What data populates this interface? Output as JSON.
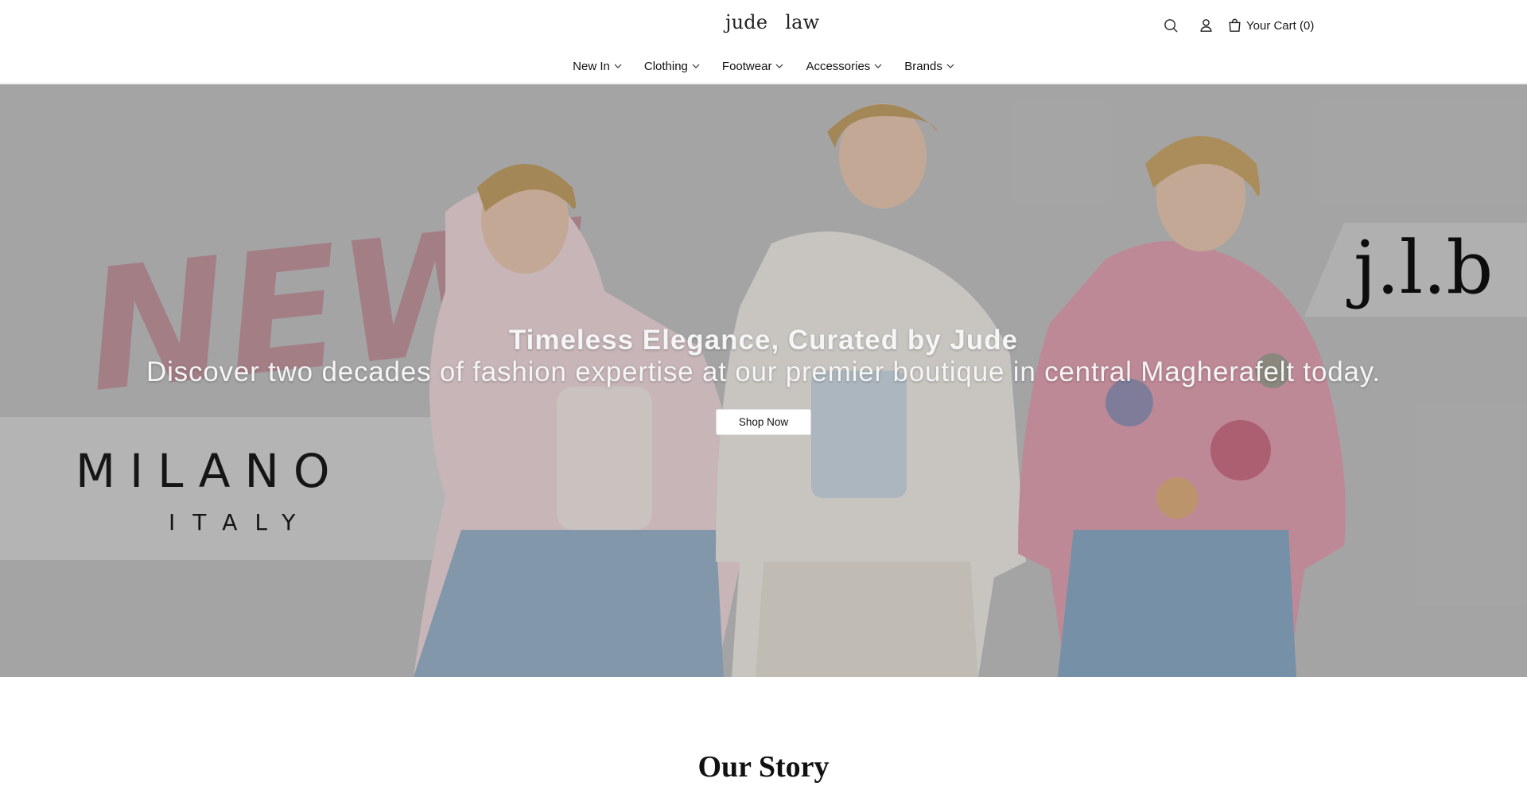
{
  "header": {
    "logo_left": "jude",
    "logo_right": "law",
    "cart_label": "Your Cart (0)"
  },
  "nav": {
    "items": [
      {
        "label": "New In"
      },
      {
        "label": "Clothing"
      },
      {
        "label": "Footwear"
      },
      {
        "label": "Accessories"
      },
      {
        "label": "Brands"
      }
    ]
  },
  "hero": {
    "title": "Timeless Elegance, Curated by Jude",
    "subtitle": "Discover two decades of fashion expertise at our premier boutique in central Magherafelt today.",
    "cta_label": "Shop Now",
    "banner_new": "NEW!",
    "banner_brand_left": "MILANO",
    "banner_brand_left_sub": "ITALY",
    "banner_brand_right": "j.l.b"
  },
  "story": {
    "title": "Our Story"
  },
  "icons": {
    "search": "search-icon",
    "account": "user-icon",
    "cart": "shopping-bag-icon",
    "nav_chevron": "chevron-down-icon"
  },
  "colors": {
    "header_bg": "#ffffff",
    "text": "#111111",
    "hero_overlay": "#00000030",
    "new_pink": "#b88a93"
  }
}
